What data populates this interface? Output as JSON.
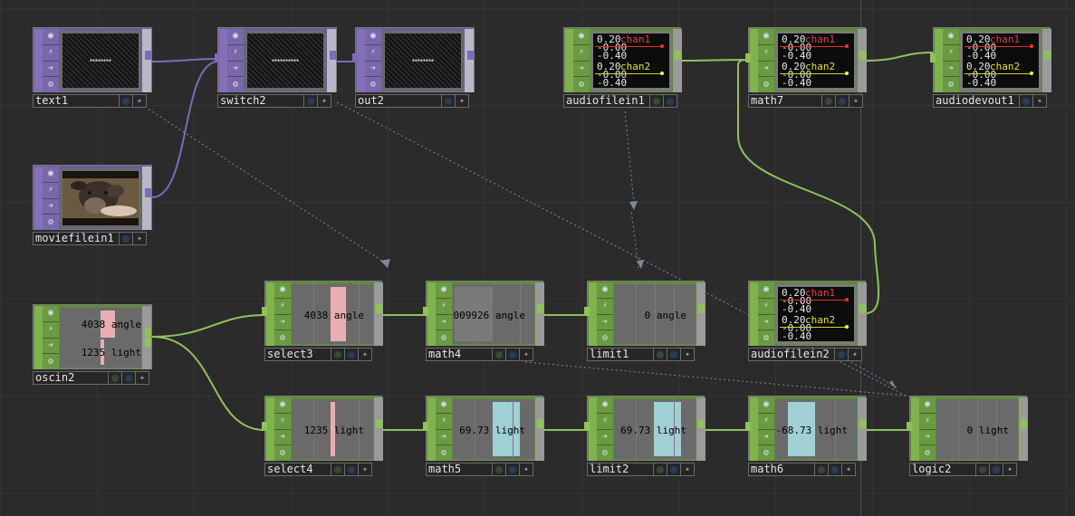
{
  "colors": {
    "background": "#2b2b2b",
    "top_operator": "#6b5b96",
    "chop_operator": "#5d8a3a",
    "wire_top": "#7d6ab8",
    "wire_chop": "#8fc25a",
    "angle_bar": "#e8aeb2",
    "light_bar": "#9fd0d6"
  },
  "nodes": {
    "text1": {
      "name": "text1"
    },
    "switch2": {
      "name": "switch2"
    },
    "out2": {
      "name": "out2"
    },
    "moviefilein1": {
      "name": "moviefilein1"
    },
    "audiofilein1": {
      "name": "audiofilein1"
    },
    "math7": {
      "name": "math7"
    },
    "audiodevout1": {
      "name": "audiodevout1"
    },
    "oscin2": {
      "name": "oscin2",
      "angle": "4038 angle",
      "light": "1235 light"
    },
    "select3": {
      "name": "select3",
      "value": "4038 angle"
    },
    "math4": {
      "name": "math4",
      "value": "009926 angle"
    },
    "limit1": {
      "name": "limit1",
      "value": "0 angle"
    },
    "audiofilein2": {
      "name": "audiofilein2"
    },
    "select4": {
      "name": "select4",
      "value": "1235 light"
    },
    "math5": {
      "name": "math5",
      "value": "69.73 light"
    },
    "limit2": {
      "name": "limit2",
      "value": "69.73 light"
    },
    "math6": {
      "name": "math6",
      "value": "-68.73 light"
    },
    "logic2": {
      "name": "logic2",
      "value": "0 light"
    }
  },
  "audio_preview": {
    "row1a": "0.20",
    "row1b": "-0.00",
    "row1c": "-0.40",
    "row2a": "0.20",
    "row2b": "-0.00",
    "row2c": "-0.40",
    "chan1": "chan1",
    "chan2": "chan2"
  },
  "icons": [
    "bypass-icon",
    "lock-icon",
    "display-icon",
    "viewer-icon"
  ]
}
